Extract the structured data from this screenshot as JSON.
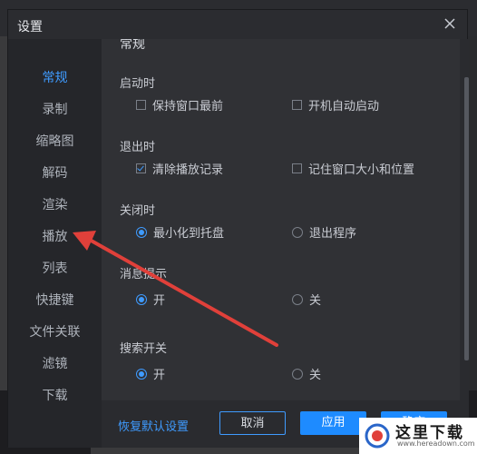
{
  "dialog": {
    "title": "设置",
    "close_icon": "close-icon"
  },
  "sidebar": {
    "items": [
      {
        "label": "常规",
        "active": true
      },
      {
        "label": "录制",
        "active": false
      },
      {
        "label": "缩略图",
        "active": false
      },
      {
        "label": "解码",
        "active": false
      },
      {
        "label": "渲染",
        "active": false
      },
      {
        "label": "播放",
        "active": false
      },
      {
        "label": "列表",
        "active": false
      },
      {
        "label": "快捷键",
        "active": false
      },
      {
        "label": "文件关联",
        "active": false
      },
      {
        "label": "滤镜",
        "active": false
      },
      {
        "label": "下载",
        "active": false
      }
    ]
  },
  "content": {
    "header": "常规",
    "startup": {
      "title": "启动时",
      "keep_on_top": {
        "label": "保持窗口最前",
        "checked": false
      },
      "auto_start": {
        "label": "开机自动启动",
        "checked": false
      }
    },
    "exit": {
      "title": "退出时",
      "clear_history": {
        "label": "清除播放记录",
        "checked": true
      },
      "remember_window": {
        "label": "记住窗口大小和位置",
        "checked": false
      }
    },
    "close": {
      "title": "关闭时",
      "minimize_tray": {
        "label": "最小化到托盘",
        "checked": true
      },
      "exit_program": {
        "label": "退出程序",
        "checked": false
      }
    },
    "message": {
      "title": "消息提示",
      "on": {
        "label": "开",
        "checked": true
      },
      "off": {
        "label": "关",
        "checked": false
      }
    },
    "search": {
      "title": "搜索开关",
      "on": {
        "label": "开",
        "checked": true
      },
      "off": {
        "label": "关",
        "checked": false
      }
    }
  },
  "footer": {
    "restore_label": "恢复默认设置",
    "cancel_label": "取消",
    "apply_label": "应用",
    "ok_label": "确定"
  },
  "watermark": {
    "text": "这里下载",
    "url": "www.hereadown.com"
  },
  "colors": {
    "accent": "#3f9bff",
    "arrow": "#e0403a"
  }
}
